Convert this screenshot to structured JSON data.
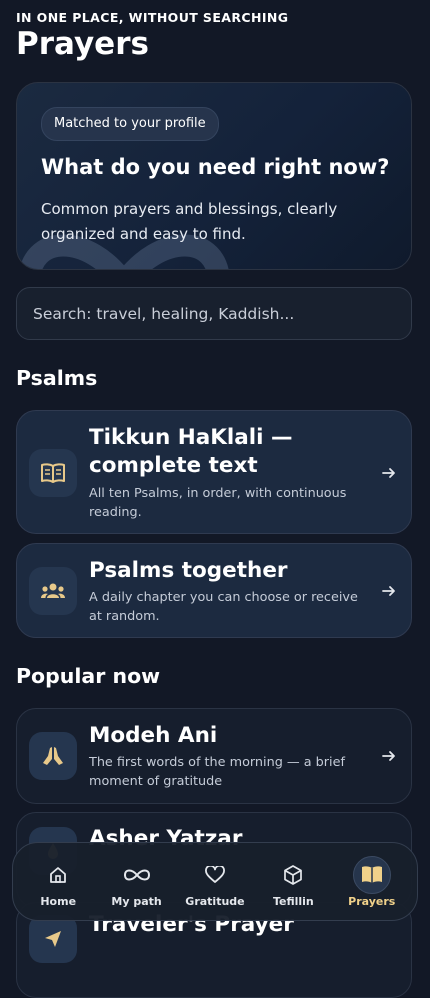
{
  "header": {
    "eyebrow": "IN ONE PLACE, WITHOUT SEARCHING",
    "title": "Prayers"
  },
  "hero": {
    "badge": "Matched to your profile",
    "headline": "What do you need right now?",
    "description": "Common prayers and blessings, clearly organized and easy to find."
  },
  "search": {
    "placeholder": "Search: travel, healing, Kaddish..."
  },
  "sections": {
    "psalms": "Psalms",
    "popular": "Popular now"
  },
  "psalms": [
    {
      "title": "Tikkun HaKlali — complete text",
      "subtitle": "All ten Psalms, in order, with continuous reading.",
      "icon": "open-book-icon"
    },
    {
      "title": "Psalms together",
      "subtitle": "A daily chapter you can choose or receive at random.",
      "icon": "group-icon"
    }
  ],
  "popular": [
    {
      "title": "Modeh Ani",
      "subtitle": "The first words of the morning — a brief moment of gratitude",
      "icon": "praying-hands-icon"
    },
    {
      "title": "Asher Yatzar",
      "icon": "drop-icon"
    },
    {
      "title": "Traveler's Prayer",
      "icon": "paper-plane-icon"
    }
  ],
  "nav": [
    {
      "label": "Home",
      "icon": "home-icon",
      "active": false
    },
    {
      "label": "My path",
      "icon": "infinity-icon",
      "active": false
    },
    {
      "label": "Gratitude",
      "icon": "heart-icon",
      "active": false
    },
    {
      "label": "Tefillin",
      "icon": "cube-icon",
      "active": false
    },
    {
      "label": "Prayers",
      "icon": "open-book-icon",
      "active": true
    }
  ],
  "colors": {
    "background": "#121826",
    "card_blue": "#1c2a40",
    "card_dark": "#161e2d",
    "accent_gold": "#f0d18a",
    "icon_gold": "#e8c98a"
  }
}
